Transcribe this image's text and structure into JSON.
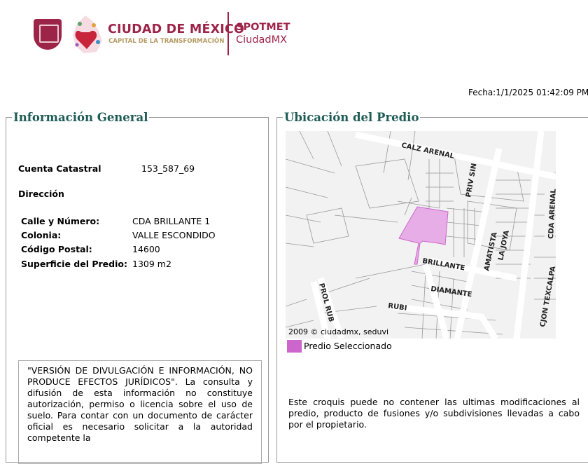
{
  "header": {
    "logo_title": "CIUDAD DE MÉXICO",
    "logo_subtitle": "CAPITAL DE LA TRANSFORMACIÓN",
    "app_name": "SPOTMET",
    "app_sub": "CiudadMX",
    "fecha": "Fecha:1/1/2025 01:42:09 PM"
  },
  "info": {
    "title": "Información General",
    "cuenta_label": "Cuenta Catastral",
    "cuenta_value": "153_587_69",
    "direccion_label": "Dirección",
    "fields": [
      {
        "label": "Calle y Número:",
        "value": "CDA BRILLANTE 1"
      },
      {
        "label": "Colonia:",
        "value": "VALLE ESCONDIDO"
      },
      {
        "label": "Código Postal:",
        "value": "14600"
      },
      {
        "label": "Superficie del Predio:",
        "value": "1309 m2"
      }
    ],
    "disclaimer": "\"VERSIÓN DE DIVULGACIÓN E INFORMACIÓN, NO PRODUCE EFECTOS JURÍDICOS\". La consulta y difusión de esta información no constituye autorización, permiso o licencia sobre el uso de suelo. Para contar con un documento de carácter oficial es necesario solicitar a la autoridad competente la"
  },
  "ubicacion": {
    "title": "Ubicación del Predio",
    "streets": [
      "CALZ ARENAL",
      "PRIV SIN",
      "AMATISTA",
      "LA JOYA",
      "CDA ARENAL",
      "BRILLANTE",
      "DIAMANTE",
      "RUBI",
      "PROL RUB",
      "CJON TEXCALPA"
    ],
    "copyright": "2009 © ciudadmx, seduvi",
    "legend_label": "Predio Seleccionado",
    "legend_color": "#cc66cc",
    "note": "Este croquis puede no contener las ultimas modificaciones al predio, producto de fusiones y/o subdivisiones llevadas a cabo por el propietario."
  }
}
